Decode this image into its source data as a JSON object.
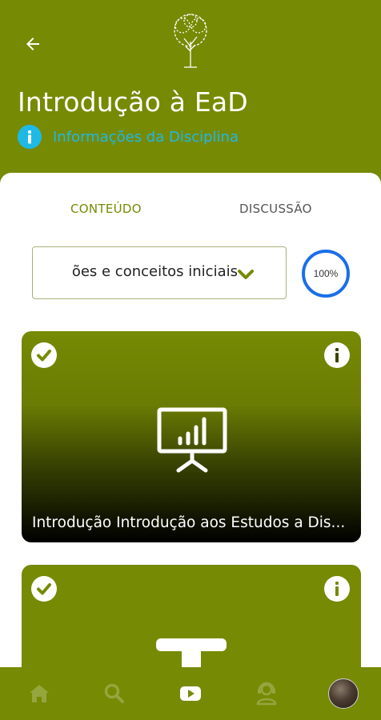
{
  "header": {
    "title": "Introdução à EaD",
    "info_link": "Informações da Disciplina",
    "logo_icon": "tree-logo-icon",
    "back_icon": "back-arrow-icon"
  },
  "tabs": [
    {
      "label": "CONTEÚDO",
      "active": true
    },
    {
      "label": "DISCUSSÃO",
      "active": false
    }
  ],
  "module_select": {
    "value": "Noções e conceitos iniciais",
    "visible_text": "ões e conceitos iniciais"
  },
  "progress": {
    "label": "100%",
    "value": 1.0
  },
  "cards": [
    {
      "title": "Introdução Introdução aos Estudos a Dis...",
      "icon": "presentation-chart-icon",
      "completed": true
    },
    {
      "title": "",
      "icon": "text-icon",
      "completed": true
    }
  ],
  "bottom_nav": [
    {
      "name": "home-icon"
    },
    {
      "name": "search-icon"
    },
    {
      "name": "video-icon",
      "active": true
    },
    {
      "name": "support-agent-icon"
    },
    {
      "name": "avatar"
    }
  ],
  "colors": {
    "primary": "#768a03",
    "accent_blue": "#20b8e8",
    "progress_blue": "#1a6fe8",
    "white": "#ffffff"
  }
}
